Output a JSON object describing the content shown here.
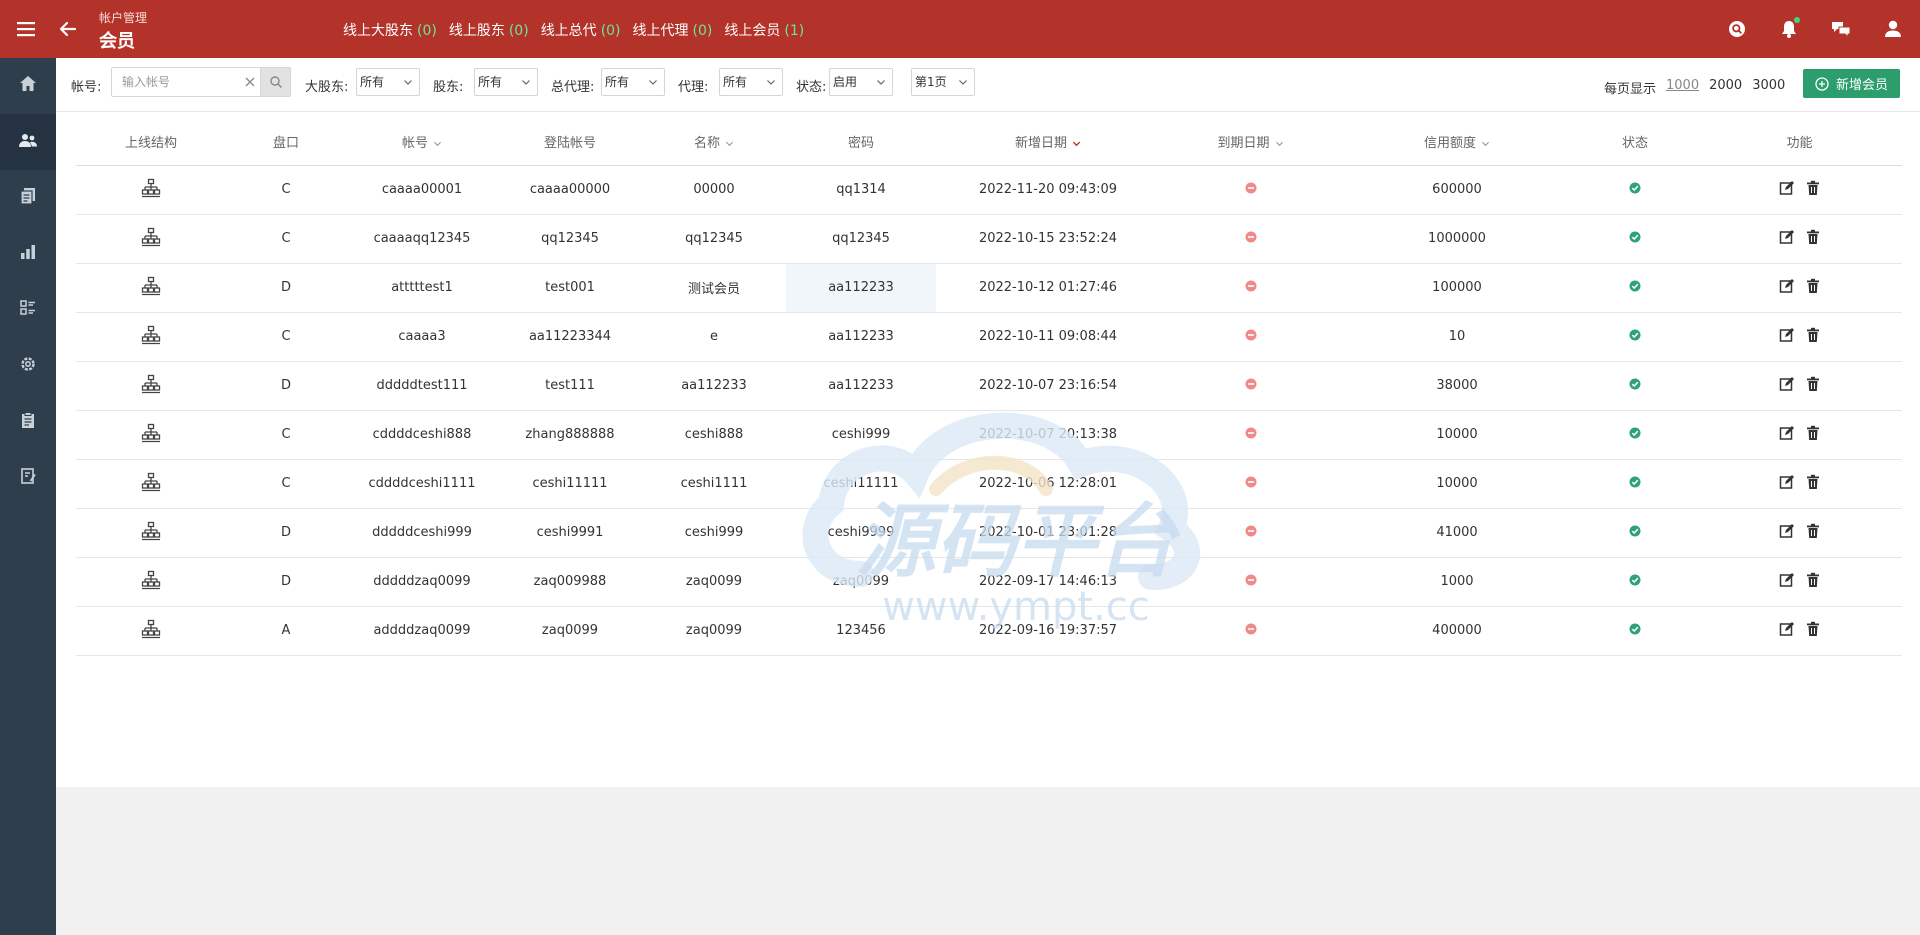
{
  "header": {
    "breadcrumb": "帐户管理",
    "title": "会员",
    "online": [
      {
        "label": "线上大股东",
        "count": "(0)"
      },
      {
        "label": "线上股东",
        "count": "(0)"
      },
      {
        "label": "线上总代",
        "count": "(0)"
      },
      {
        "label": "线上代理",
        "count": "(0)"
      },
      {
        "label": "线上会员",
        "count": "(1)"
      }
    ],
    "icons": [
      "search-icon",
      "bell-icon",
      "chat-icon",
      "user-icon"
    ]
  },
  "sidebar": {
    "items": [
      {
        "icon": "home-icon"
      },
      {
        "icon": "users-icon",
        "active": true
      },
      {
        "icon": "documents-icon"
      },
      {
        "icon": "bar-chart-icon"
      },
      {
        "icon": "list-icon"
      },
      {
        "icon": "gear-icon"
      },
      {
        "icon": "clipboard-icon"
      },
      {
        "icon": "notebook-icon"
      }
    ]
  },
  "filters": {
    "account_label": "帐号:",
    "account_placeholder": "输入帐号",
    "major_shareholder_label": "大股东:",
    "major_shareholder_value": "所有",
    "shareholder_label": "股东:",
    "shareholder_value": "所有",
    "general_agent_label": "总代理:",
    "general_agent_value": "所有",
    "agent_label": "代理:",
    "agent_value": "所有",
    "status_label": "状态:",
    "status_value": "启用",
    "page_value": "第1页",
    "per_page_label": "每页显示",
    "per_page_options": [
      "1000",
      "2000",
      "3000"
    ],
    "add_button": "新增会员"
  },
  "table": {
    "columns": [
      "上线结构",
      "盘口",
      "帐号",
      "登陆帐号",
      "名称",
      "密码",
      "新增日期",
      "到期日期",
      "信用额度",
      "状态",
      "功能"
    ],
    "rows": [
      {
        "market": "C",
        "account": "caaaa00001",
        "login": "caaaa00000",
        "name": "00000",
        "password": "qq1314",
        "created": "2022-11-20 09:43:09",
        "credit": "600000"
      },
      {
        "market": "C",
        "account": "caaaaqq12345",
        "login": "qq12345",
        "name": "qq12345",
        "password": "qq12345",
        "created": "2022-10-15 23:52:24",
        "credit": "1000000"
      },
      {
        "market": "D",
        "account": "atttttest1",
        "login": "test001",
        "name": "测试会员",
        "password": "aa112233",
        "created": "2022-10-12 01:27:46",
        "credit": "100000"
      },
      {
        "market": "C",
        "account": "caaaa3",
        "login": "aa11223344",
        "name": "e",
        "password": "aa112233",
        "created": "2022-10-11 09:08:44",
        "credit": "10"
      },
      {
        "market": "D",
        "account": "dddddtest111",
        "login": "test111",
        "name": "aa112233",
        "password": "aa112233",
        "created": "2022-10-07 23:16:54",
        "credit": "38000"
      },
      {
        "market": "C",
        "account": "cddddceshi888",
        "login": "zhang888888",
        "name": "ceshi888",
        "password": "ceshi999",
        "created": "2022-10-07 20:13:38",
        "credit": "10000"
      },
      {
        "market": "C",
        "account": "cddddceshi1111",
        "login": "ceshi11111",
        "name": "ceshi1111",
        "password": "ceshi11111",
        "created": "2022-10-06 12:28:01",
        "credit": "10000"
      },
      {
        "market": "D",
        "account": "dddddceshi999",
        "login": "ceshi9991",
        "name": "ceshi999",
        "password": "ceshi9999",
        "created": "2022-10-01 23:01:28",
        "credit": "41000"
      },
      {
        "market": "D",
        "account": "dddddzaq0099",
        "login": "zaq009988",
        "name": "zaq0099",
        "password": "zaq0099",
        "created": "2022-09-17 14:46:13",
        "credit": "1000"
      },
      {
        "market": "A",
        "account": "addddzaq0099",
        "login": "zaq0099",
        "name": "zaq0099",
        "password": "123456",
        "created": "2022-09-16 19:37:57",
        "credit": "400000"
      }
    ]
  },
  "watermark": {
    "title": "源码平台",
    "url": "www.ympt.cc"
  },
  "colors": {
    "header": "#b3332a",
    "sidebar": "#2f3e4d",
    "accent_green": "#2c9d6d",
    "expire_red": "#f08a8a",
    "status_green": "#2ea27a"
  }
}
